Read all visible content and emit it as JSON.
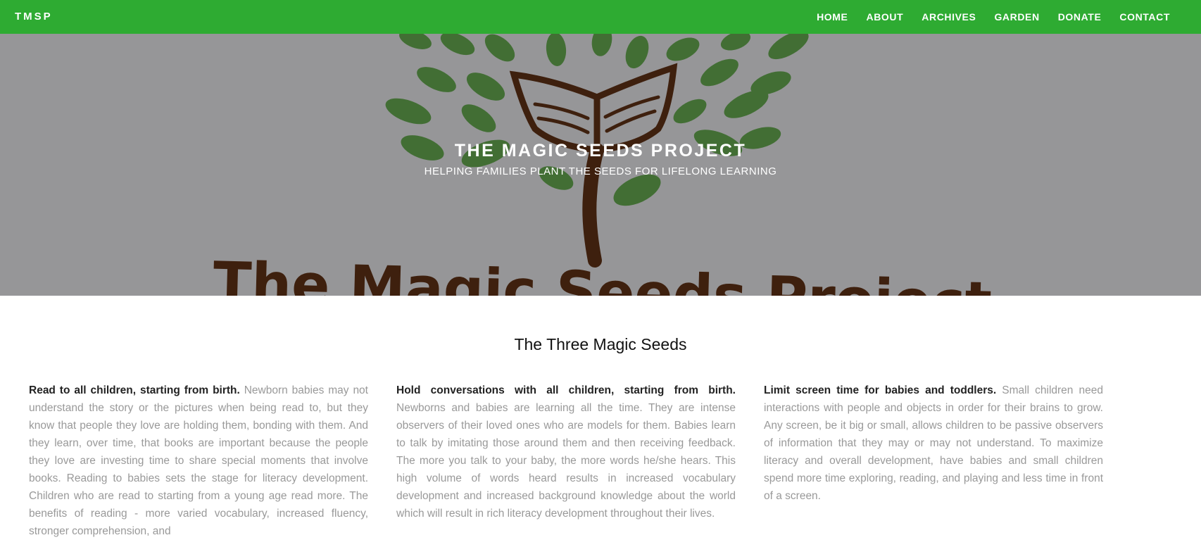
{
  "nav": {
    "brand": "TMSP",
    "links": [
      "HOME",
      "ABOUT",
      "ARCHIVES",
      "GARDEN",
      "DONATE",
      "CONTACT"
    ]
  },
  "hero": {
    "title": "THE MAGIC SEEDS PROJECT",
    "subtitle": "HELPING FAMILIES PLANT THE SEEDS FOR LIFELONG LEARNING",
    "logo_text": "The Magic Seeds Project"
  },
  "section": {
    "title": "The Three Magic Seeds",
    "columns": [
      {
        "lead": "Read to all children, starting from birth.",
        "text": "Newborn babies may not understand the story or the pictures when being read to, but they know that people they love are holding them, bonding with them. And they learn, over time, that books are important because the people they love are investing time to share special moments that involve books. Reading to babies sets the stage for literacy development. Children who are read to starting from a young age read more. The benefits of reading - more varied vocabulary, increased fluency, stronger comprehension, and"
      },
      {
        "lead": "Hold conversations with all children, starting from birth.",
        "text": "Newborns and babies are learning all the time. They are intense observers of their loved ones who are models for them. Babies learn to talk by imitating those around them and then receiving feedback. The more you talk to your baby, the more words he/she hears. This high volume of words heard results in increased vocabulary development and increased background knowledge about the world which will result in rich literacy development throughout their lives."
      },
      {
        "lead": "Limit screen time for babies and toddlers.",
        "text": "Small children need interactions with people and objects in order for their brains to grow. Any screen, be it big or small, allows children to be passive observers of information that they may or may not understand. To maximize literacy and overall development, have babies and small children spend more time exploring, reading, and playing and less time in front of a screen."
      }
    ]
  },
  "colors": {
    "nav_green": "#2eab32",
    "hero_overlay": "#969698",
    "leaf_green": "#3b6b2c",
    "trunk_brown": "#3e200e",
    "body_text": "#999999",
    "lead_text": "#222222"
  },
  "icons": [
    "tree-logo-icon"
  ]
}
